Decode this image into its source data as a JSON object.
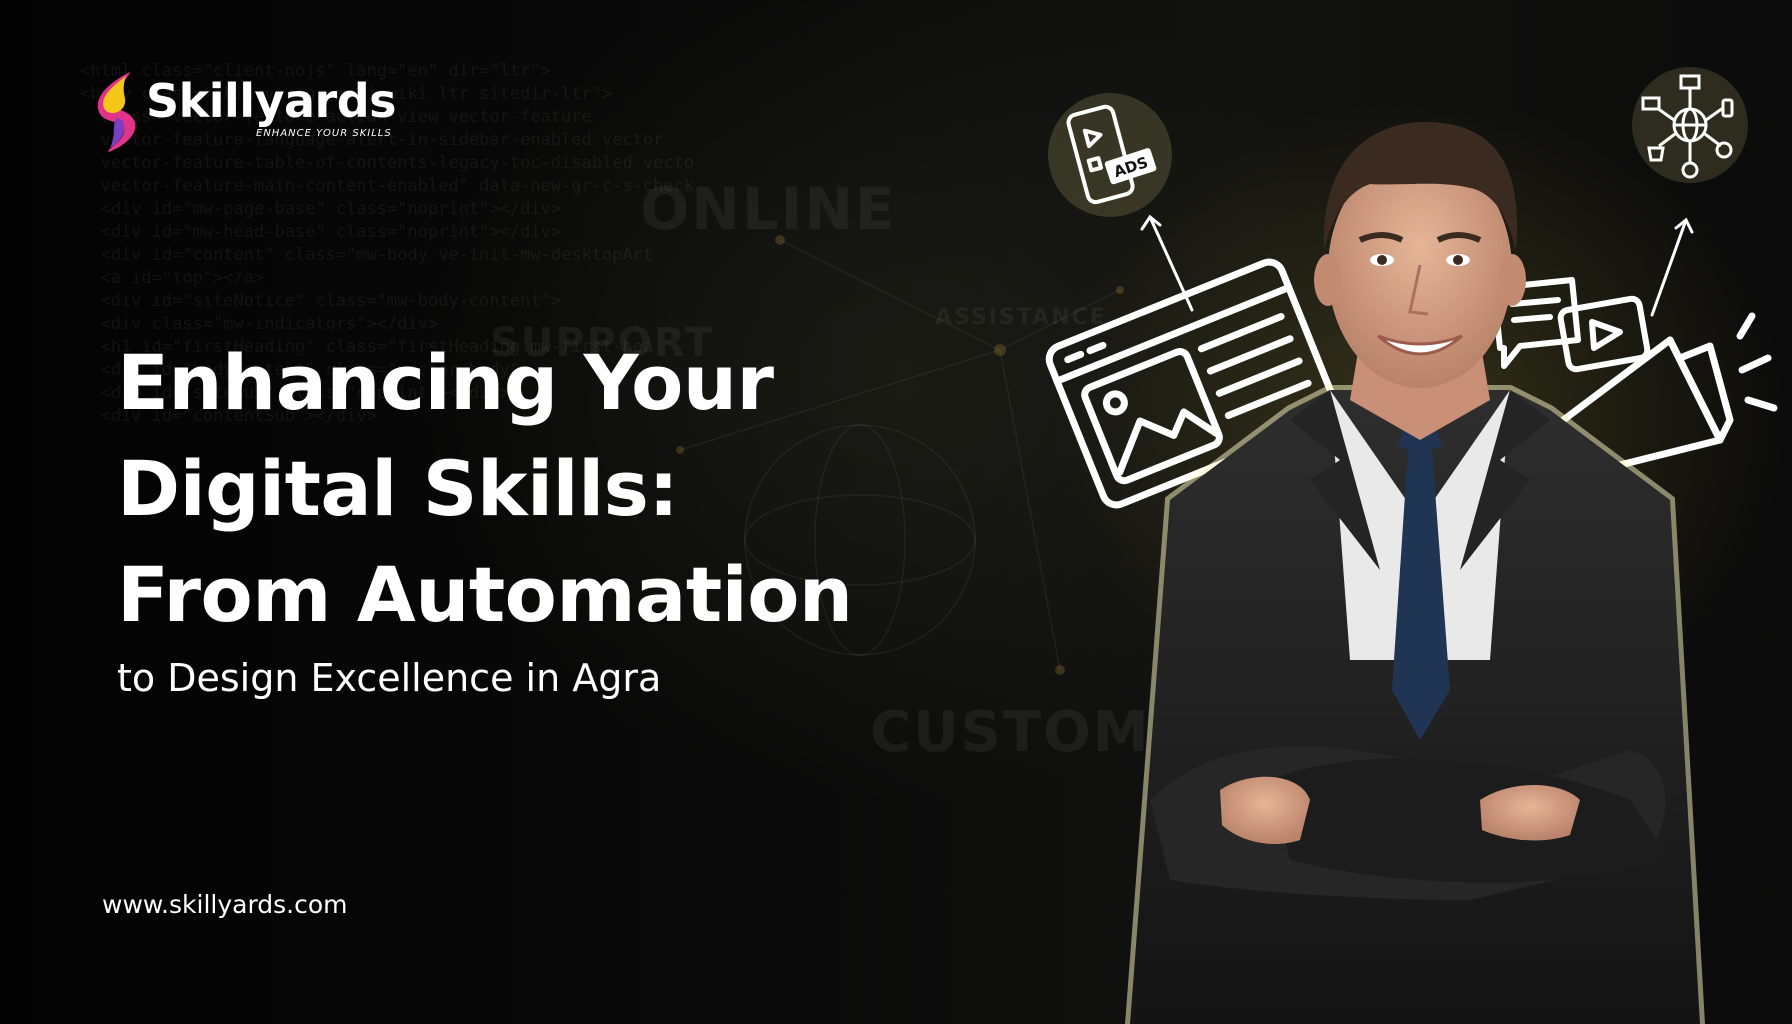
{
  "brand": {
    "name": "Skillyards",
    "tagline": "ENHANCE YOUR SKILLS",
    "colors": {
      "gold": "#f5c518",
      "magenta": "#e0338a",
      "purple": "#7b3fc4"
    }
  },
  "headline": {
    "line1": "Enhancing Your",
    "line2": "Digital Skills:",
    "line3": "From Automation",
    "subline": "to Design Excellence in Agra"
  },
  "website": "www.skillyards.com",
  "illustration": {
    "ads_badge": "ADS",
    "icons": [
      "phone-ads-icon",
      "webpage-layout-icon",
      "video-chat-icon",
      "megaphone-icon",
      "digital-network-icon"
    ]
  },
  "accent": "#d8cf7a"
}
